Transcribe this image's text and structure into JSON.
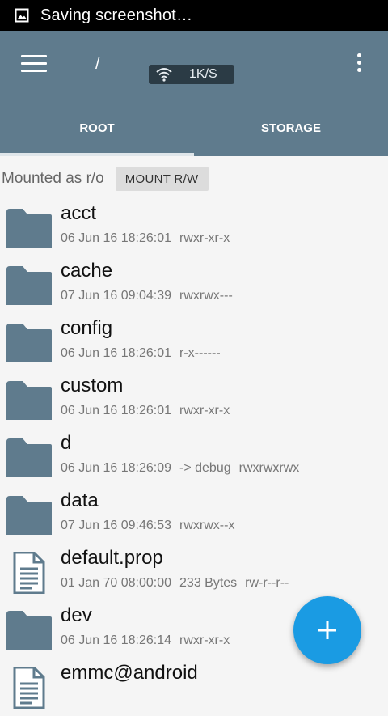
{
  "status_bar": {
    "text": "Saving screenshot…"
  },
  "network_speed": {
    "text": "1K/S"
  },
  "app_bar": {
    "path": "/"
  },
  "tabs": [
    {
      "label": "ROOT"
    },
    {
      "label": "STORAGE"
    }
  ],
  "mount": {
    "status": "Mounted as r/o",
    "button": "MOUNT R/W"
  },
  "files": [
    {
      "name": "acct",
      "type": "folder",
      "date": "06 Jun 16 18:26:01",
      "extra": "",
      "perms": "rwxr-xr-x"
    },
    {
      "name": "cache",
      "type": "folder",
      "date": "07 Jun 16 09:04:39",
      "extra": "",
      "perms": "rwxrwx---"
    },
    {
      "name": "config",
      "type": "folder",
      "date": "06 Jun 16 18:26:01",
      "extra": "",
      "perms": "r-x------"
    },
    {
      "name": "custom",
      "type": "folder",
      "date": "06 Jun 16 18:26:01",
      "extra": "",
      "perms": "rwxr-xr-x"
    },
    {
      "name": "d",
      "type": "folder",
      "date": "06 Jun 16 18:26:09",
      "extra": "-> debug",
      "perms": "rwxrwxrwx"
    },
    {
      "name": "data",
      "type": "folder",
      "date": "07 Jun 16 09:46:53",
      "extra": "",
      "perms": "rwxrwx--x"
    },
    {
      "name": "default.prop",
      "type": "file",
      "date": "01 Jan 70 08:00:00",
      "extra": "233 Bytes",
      "perms": "rw-r--r--"
    },
    {
      "name": "dev",
      "type": "folder",
      "date": "06 Jun 16 18:26:14",
      "extra": "",
      "perms": "rwxr-xr-x"
    },
    {
      "name": "emmc@android",
      "type": "file",
      "date": "",
      "extra": "",
      "perms": ""
    }
  ],
  "colors": {
    "app_bar": "#5f7b8d",
    "folder_icon": "#5f7b8d",
    "fab": "#1a9be3"
  }
}
